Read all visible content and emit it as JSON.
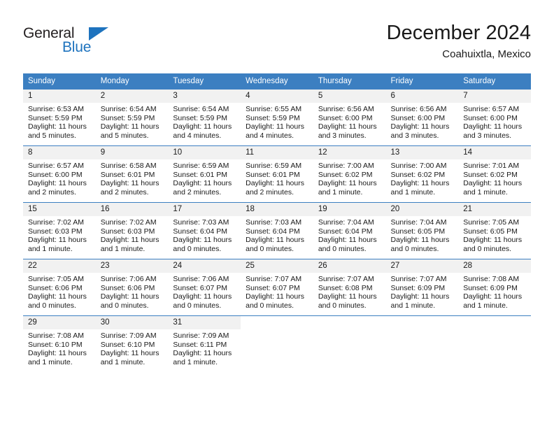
{
  "brand": {
    "name_top": "General",
    "name_bottom": "Blue",
    "accent_color": "#1e73be",
    "triangle_icon": "triangle-icon"
  },
  "header": {
    "title": "December 2024",
    "subtitle": "Coahuixtla, Mexico"
  },
  "calendar": {
    "header_bg": "#3c7fc1",
    "header_text_color": "#ffffff",
    "daynum_bg": "#f1f1f1",
    "weekday_headers": [
      "Sunday",
      "Monday",
      "Tuesday",
      "Wednesday",
      "Thursday",
      "Friday",
      "Saturday"
    ],
    "weeks": [
      [
        {
          "day": "1",
          "sunrise": "Sunrise: 6:53 AM",
          "sunset": "Sunset: 5:59 PM",
          "daylight": "Daylight: 11 hours and 5 minutes."
        },
        {
          "day": "2",
          "sunrise": "Sunrise: 6:54 AM",
          "sunset": "Sunset: 5:59 PM",
          "daylight": "Daylight: 11 hours and 5 minutes."
        },
        {
          "day": "3",
          "sunrise": "Sunrise: 6:54 AM",
          "sunset": "Sunset: 5:59 PM",
          "daylight": "Daylight: 11 hours and 4 minutes."
        },
        {
          "day": "4",
          "sunrise": "Sunrise: 6:55 AM",
          "sunset": "Sunset: 5:59 PM",
          "daylight": "Daylight: 11 hours and 4 minutes."
        },
        {
          "day": "5",
          "sunrise": "Sunrise: 6:56 AM",
          "sunset": "Sunset: 6:00 PM",
          "daylight": "Daylight: 11 hours and 3 minutes."
        },
        {
          "day": "6",
          "sunrise": "Sunrise: 6:56 AM",
          "sunset": "Sunset: 6:00 PM",
          "daylight": "Daylight: 11 hours and 3 minutes."
        },
        {
          "day": "7",
          "sunrise": "Sunrise: 6:57 AM",
          "sunset": "Sunset: 6:00 PM",
          "daylight": "Daylight: 11 hours and 3 minutes."
        }
      ],
      [
        {
          "day": "8",
          "sunrise": "Sunrise: 6:57 AM",
          "sunset": "Sunset: 6:00 PM",
          "daylight": "Daylight: 11 hours and 2 minutes."
        },
        {
          "day": "9",
          "sunrise": "Sunrise: 6:58 AM",
          "sunset": "Sunset: 6:01 PM",
          "daylight": "Daylight: 11 hours and 2 minutes."
        },
        {
          "day": "10",
          "sunrise": "Sunrise: 6:59 AM",
          "sunset": "Sunset: 6:01 PM",
          "daylight": "Daylight: 11 hours and 2 minutes."
        },
        {
          "day": "11",
          "sunrise": "Sunrise: 6:59 AM",
          "sunset": "Sunset: 6:01 PM",
          "daylight": "Daylight: 11 hours and 2 minutes."
        },
        {
          "day": "12",
          "sunrise": "Sunrise: 7:00 AM",
          "sunset": "Sunset: 6:02 PM",
          "daylight": "Daylight: 11 hours and 1 minute."
        },
        {
          "day": "13",
          "sunrise": "Sunrise: 7:00 AM",
          "sunset": "Sunset: 6:02 PM",
          "daylight": "Daylight: 11 hours and 1 minute."
        },
        {
          "day": "14",
          "sunrise": "Sunrise: 7:01 AM",
          "sunset": "Sunset: 6:02 PM",
          "daylight": "Daylight: 11 hours and 1 minute."
        }
      ],
      [
        {
          "day": "15",
          "sunrise": "Sunrise: 7:02 AM",
          "sunset": "Sunset: 6:03 PM",
          "daylight": "Daylight: 11 hours and 1 minute."
        },
        {
          "day": "16",
          "sunrise": "Sunrise: 7:02 AM",
          "sunset": "Sunset: 6:03 PM",
          "daylight": "Daylight: 11 hours and 1 minute."
        },
        {
          "day": "17",
          "sunrise": "Sunrise: 7:03 AM",
          "sunset": "Sunset: 6:04 PM",
          "daylight": "Daylight: 11 hours and 0 minutes."
        },
        {
          "day": "18",
          "sunrise": "Sunrise: 7:03 AM",
          "sunset": "Sunset: 6:04 PM",
          "daylight": "Daylight: 11 hours and 0 minutes."
        },
        {
          "day": "19",
          "sunrise": "Sunrise: 7:04 AM",
          "sunset": "Sunset: 6:04 PM",
          "daylight": "Daylight: 11 hours and 0 minutes."
        },
        {
          "day": "20",
          "sunrise": "Sunrise: 7:04 AM",
          "sunset": "Sunset: 6:05 PM",
          "daylight": "Daylight: 11 hours and 0 minutes."
        },
        {
          "day": "21",
          "sunrise": "Sunrise: 7:05 AM",
          "sunset": "Sunset: 6:05 PM",
          "daylight": "Daylight: 11 hours and 0 minutes."
        }
      ],
      [
        {
          "day": "22",
          "sunrise": "Sunrise: 7:05 AM",
          "sunset": "Sunset: 6:06 PM",
          "daylight": "Daylight: 11 hours and 0 minutes."
        },
        {
          "day": "23",
          "sunrise": "Sunrise: 7:06 AM",
          "sunset": "Sunset: 6:06 PM",
          "daylight": "Daylight: 11 hours and 0 minutes."
        },
        {
          "day": "24",
          "sunrise": "Sunrise: 7:06 AM",
          "sunset": "Sunset: 6:07 PM",
          "daylight": "Daylight: 11 hours and 0 minutes."
        },
        {
          "day": "25",
          "sunrise": "Sunrise: 7:07 AM",
          "sunset": "Sunset: 6:07 PM",
          "daylight": "Daylight: 11 hours and 0 minutes."
        },
        {
          "day": "26",
          "sunrise": "Sunrise: 7:07 AM",
          "sunset": "Sunset: 6:08 PM",
          "daylight": "Daylight: 11 hours and 0 minutes."
        },
        {
          "day": "27",
          "sunrise": "Sunrise: 7:07 AM",
          "sunset": "Sunset: 6:09 PM",
          "daylight": "Daylight: 11 hours and 1 minute."
        },
        {
          "day": "28",
          "sunrise": "Sunrise: 7:08 AM",
          "sunset": "Sunset: 6:09 PM",
          "daylight": "Daylight: 11 hours and 1 minute."
        }
      ],
      [
        {
          "day": "29",
          "sunrise": "Sunrise: 7:08 AM",
          "sunset": "Sunset: 6:10 PM",
          "daylight": "Daylight: 11 hours and 1 minute."
        },
        {
          "day": "30",
          "sunrise": "Sunrise: 7:09 AM",
          "sunset": "Sunset: 6:10 PM",
          "daylight": "Daylight: 11 hours and 1 minute."
        },
        {
          "day": "31",
          "sunrise": "Sunrise: 7:09 AM",
          "sunset": "Sunset: 6:11 PM",
          "daylight": "Daylight: 11 hours and 1 minute."
        },
        {
          "day": "",
          "sunrise": "",
          "sunset": "",
          "daylight": ""
        },
        {
          "day": "",
          "sunrise": "",
          "sunset": "",
          "daylight": ""
        },
        {
          "day": "",
          "sunrise": "",
          "sunset": "",
          "daylight": ""
        },
        {
          "day": "",
          "sunrise": "",
          "sunset": "",
          "daylight": ""
        }
      ]
    ]
  }
}
